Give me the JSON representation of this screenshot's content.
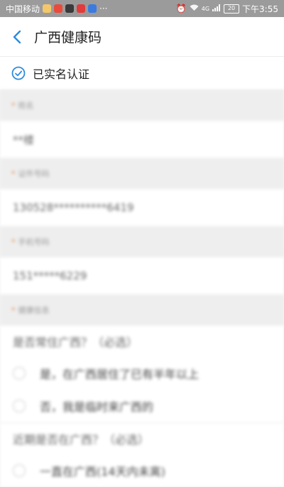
{
  "status_bar": {
    "carrier": "中国移动",
    "extra": "···",
    "network": "4G",
    "battery": "20",
    "time": "下午3:55"
  },
  "header": {
    "title": "广西健康码"
  },
  "verified_label": "已实名认证",
  "form": {
    "name_label": "姓名",
    "name_value": "**楼",
    "id_label": "证件号码",
    "id_value": "130528**********6419",
    "phone_label": "手机号码",
    "phone_value": "151*****6229",
    "health_label": "健康信息",
    "q1": "是否常住广西？（必选）",
    "q1_opt1": "是，在广西居住了已有半年以上",
    "q1_opt2": "否，我是临时来广西的",
    "q2": "近期是否在广西？（必选）",
    "q2_opt1": "一直在广西(14天内未离)"
  }
}
